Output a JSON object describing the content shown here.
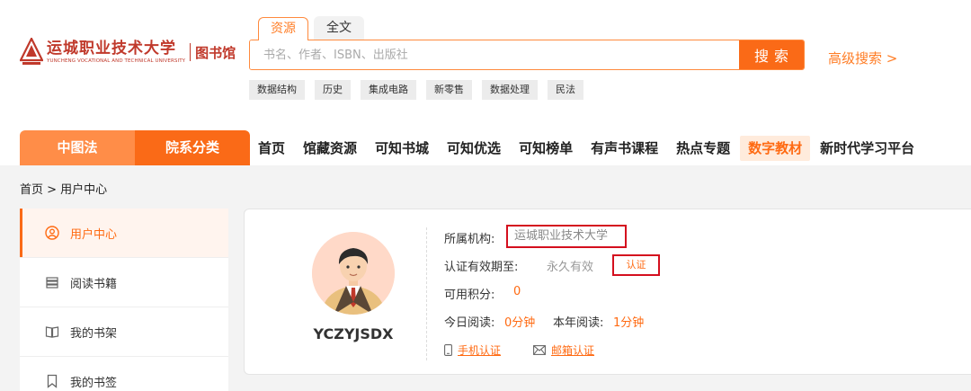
{
  "header": {
    "logo_name": "运城职业技术大学",
    "logo_english": "YUNCHENG VOCATIONAL AND TECHNICAL UNIVERSITY",
    "library_label": "图书馆"
  },
  "search": {
    "tabs": [
      "资源",
      "全文"
    ],
    "placeholder": "书名、作者、ISBN、出版社",
    "button": "搜索",
    "advanced": "高级搜索 >",
    "hot_tags": [
      "数据结构",
      "历史",
      "集成电路",
      "新零售",
      "数据处理",
      "民法"
    ]
  },
  "nav": {
    "category_tabs": [
      "中图法",
      "院系分类"
    ],
    "items": [
      "首页",
      "馆藏资源",
      "可知书城",
      "可知优选",
      "可知榜单",
      "有声书课程",
      "热点专题",
      "数字教材",
      "新时代学习平台"
    ],
    "active_item": "数字教材"
  },
  "breadcrumb": "首页 > 用户中心",
  "sidebar": {
    "items": [
      {
        "label": "用户中心",
        "icon": "user-circle-icon"
      },
      {
        "label": "阅读书籍",
        "icon": "book-stack-icon"
      },
      {
        "label": "我的书架",
        "icon": "open-book-icon"
      },
      {
        "label": "我的书签",
        "icon": "bookmark-icon"
      }
    ],
    "active_index": 0
  },
  "profile": {
    "username": "YCZYJSDX",
    "org_label": "所属机构:",
    "org_value": "运城职业技术大学",
    "validity_label": "认证有效期至:",
    "validity_value": "永久有效",
    "cert_button": "认证",
    "points_label": "可用积分:",
    "points_value": "0",
    "today_label": "今日阅读:",
    "today_value": "0分钟",
    "year_label": "本年阅读:",
    "year_value": "1分钟",
    "phone_cert": "手机认证",
    "email_cert": "邮箱认证"
  },
  "colors": {
    "accent": "#fa6a17",
    "accent_light": "#ff8d48",
    "highlight_box": "#d40f1e"
  }
}
